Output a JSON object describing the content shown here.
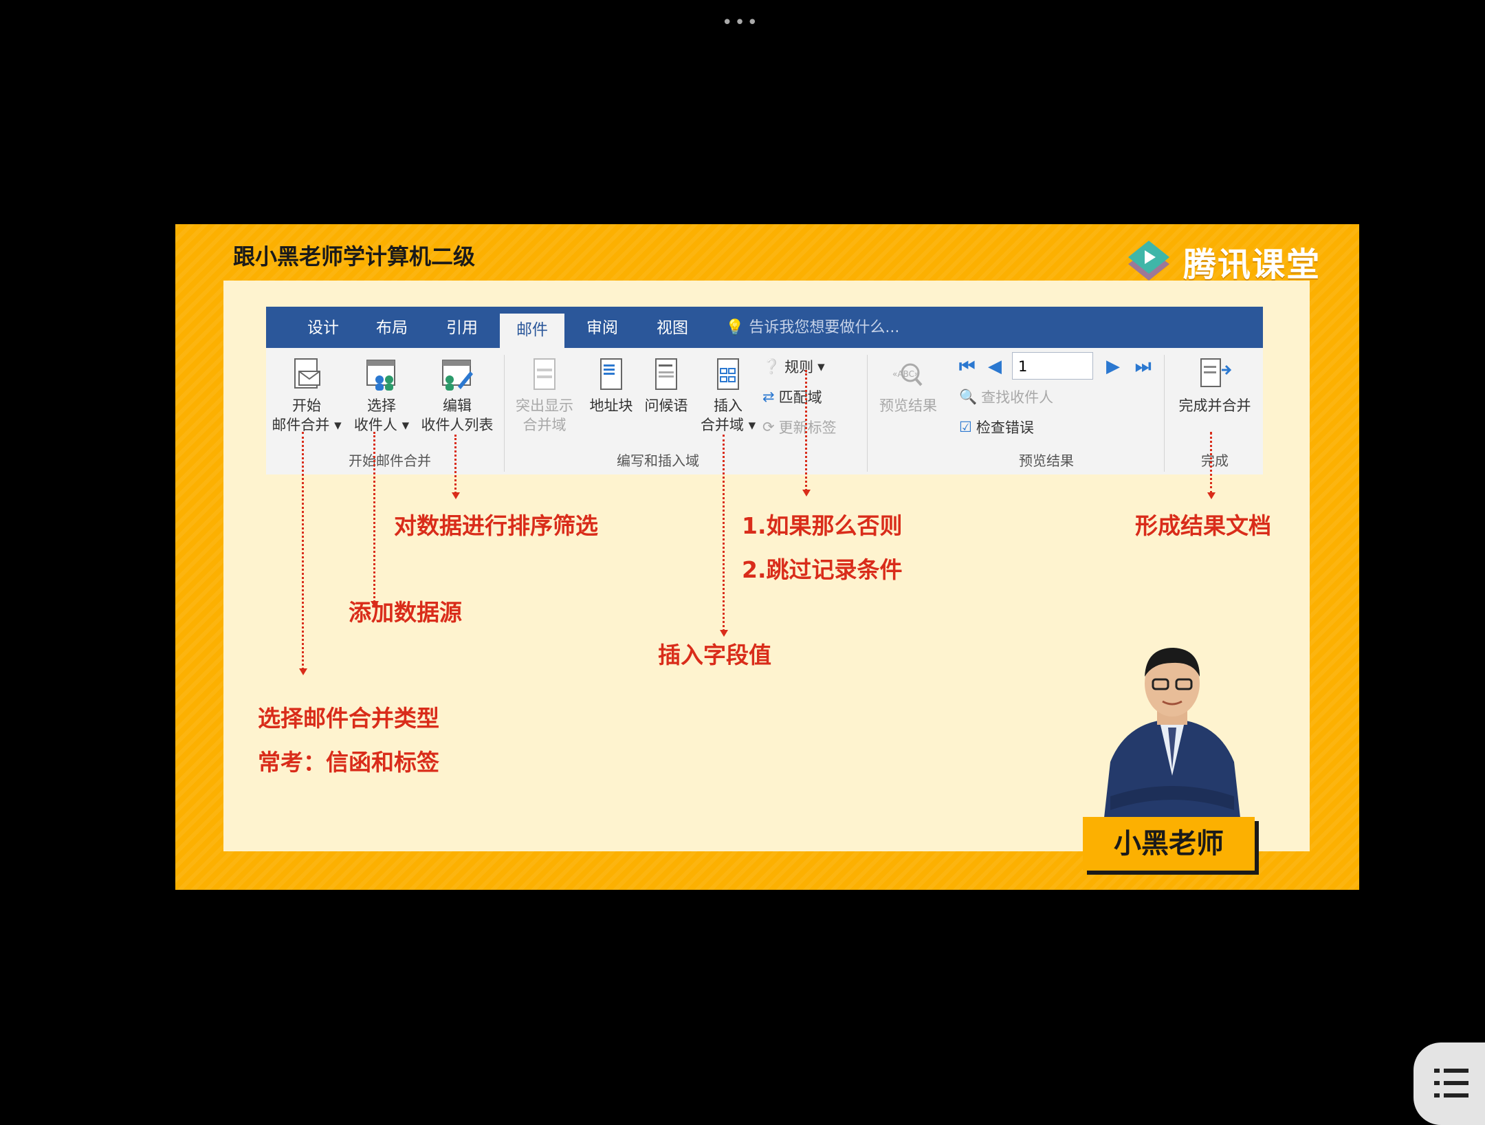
{
  "top_dots": "•••",
  "slide": {
    "course_title": "跟小黑老师学计算机二级",
    "brand_name": "腾讯课堂",
    "teacher_name": "小黑老师"
  },
  "ribbon": {
    "tabs": [
      "设计",
      "布局",
      "引用",
      "邮件",
      "审阅",
      "视图"
    ],
    "active_tab": "邮件",
    "tell_me": "告诉我您想要做什么...",
    "start_merge": {
      "line1": "开始",
      "line2": "邮件合并"
    },
    "select_recipients": {
      "line1": "选择",
      "line2": "收件人"
    },
    "edit_recipients": {
      "line1": "编辑",
      "line2": "收件人列表"
    },
    "highlight_fields": {
      "line1": "突出显示",
      "line2": "合并域"
    },
    "address_block": "地址块",
    "greeting_line": "问候语",
    "insert_merge_field": {
      "line1": "插入",
      "line2": "合并域"
    },
    "rules": "规则",
    "match_fields": "匹配域",
    "update_labels": "更新标签",
    "preview_results": "预览结果",
    "record_value": "1",
    "find_recipient": "查找收件人",
    "check_errors": "检查错误",
    "finish_merge": "完成并合并",
    "groups": {
      "start": "开始邮件合并",
      "write_insert": "编写和插入域",
      "preview": "预览结果",
      "finish": "完成"
    }
  },
  "annotations": {
    "sort_filter": "对数据进行排序筛选",
    "add_source": "添加数据源",
    "merge_type": "选择邮件合并类型",
    "common": "常考：信函和标签",
    "rule1": "1.如果那么否则",
    "rule2": "2.跳过记录条件",
    "insert_field": "插入字段值",
    "result_doc": "形成结果文档"
  },
  "colors": {
    "frame": "#fcb001",
    "panel": "#fef3cf",
    "ribbon_tabbar": "#2b579a",
    "annotation": "#d92c1a"
  }
}
